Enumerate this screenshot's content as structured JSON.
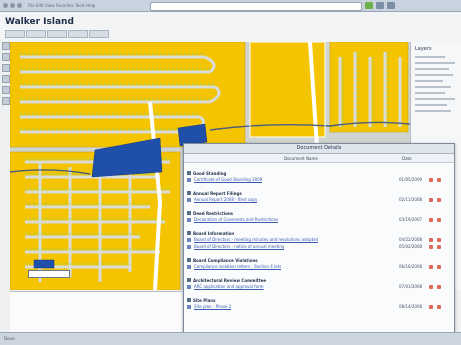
{
  "app": {
    "title": "Walker Island",
    "menu": "File  Edit  View  Favorites  Tools  Help"
  },
  "dialog": {
    "title": "Document Details",
    "col_doc": "Document Name",
    "col_date": "Date",
    "groups": [
      {
        "title": "Good Standing",
        "docs": [
          {
            "name": "Certificate of Good Standing 2009",
            "date": "01/05/2009"
          }
        ]
      },
      {
        "title": "Annual Report Filings",
        "docs": [
          {
            "name": "Annual Report 2008 - filed copy",
            "date": "02/11/2008"
          }
        ]
      },
      {
        "title": "Deed Restrictions",
        "docs": [
          {
            "name": "Declaration of Covenants and Restrictions",
            "date": "03/19/2007"
          }
        ]
      },
      {
        "title": "Board Information",
        "docs": [
          {
            "name": "Board of Directors - meeting minutes and resolutions adopted",
            "date": "04/22/2008"
          },
          {
            "name": "Board of Directors - notice of annual meeting",
            "date": "05/02/2008"
          }
        ]
      },
      {
        "title": "Board Compliance Violations",
        "docs": [
          {
            "name": "Compliance violation letters - Section 4 lots",
            "date": "06/16/2008"
          }
        ]
      },
      {
        "title": "Architectural Review Committee",
        "docs": [
          {
            "name": "ARC application and approval form",
            "date": "07/01/2008"
          }
        ]
      },
      {
        "title": "Site Plans",
        "docs": [
          {
            "name": "Site plan - Phase 2",
            "date": "08/14/2008"
          }
        ]
      }
    ]
  },
  "legend": {
    "title": "Layers"
  },
  "status": {
    "text": "Done"
  },
  "colors": {
    "parcel": "#f5c400",
    "road": "#cfd4cf",
    "water": "#1f4fa8",
    "lawn": "#8fcf6a",
    "accent": "#3a5cb0"
  }
}
